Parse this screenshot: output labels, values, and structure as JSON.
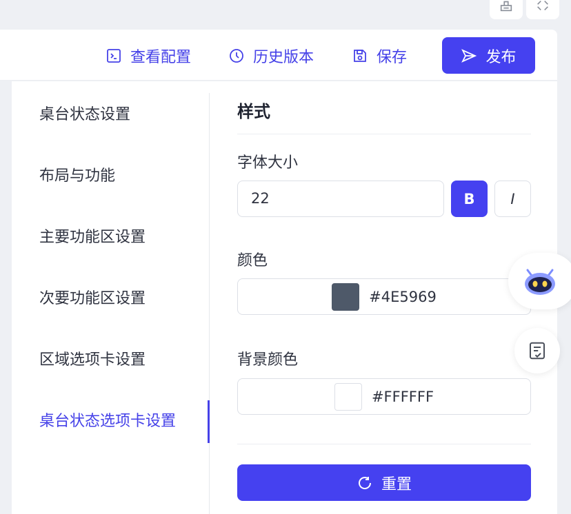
{
  "toolbar": {
    "view_config": "查看配置",
    "history": "历史版本",
    "save": "保存",
    "publish": "发布"
  },
  "nav": {
    "items": [
      "桌台状态设置",
      "布局与功能",
      "主要功能区设置",
      "次要功能区设置",
      "区域选项卡设置",
      "桌台状态选项卡设置"
    ],
    "active_index": 5
  },
  "panel": {
    "section_title": "样式",
    "font_size_label": "字体大小",
    "font_size_value": "22",
    "bold_label": "B",
    "italic_label": "I",
    "color_label": "颜色",
    "color_value": "#4E5969",
    "bg_color_label": "背景颜色",
    "bg_color_value": "#FFFFFF",
    "reset_label": "重置"
  },
  "colors": {
    "accent": "#4541F0",
    "text_swatch": "#4E5969",
    "bg_swatch": "#FFFFFF"
  },
  "icons": [
    "terminal-icon",
    "clock-icon",
    "save-icon",
    "send-icon",
    "refresh-icon",
    "robot-icon",
    "checklist-icon",
    "brush-icon",
    "fullscreen-icon"
  ]
}
